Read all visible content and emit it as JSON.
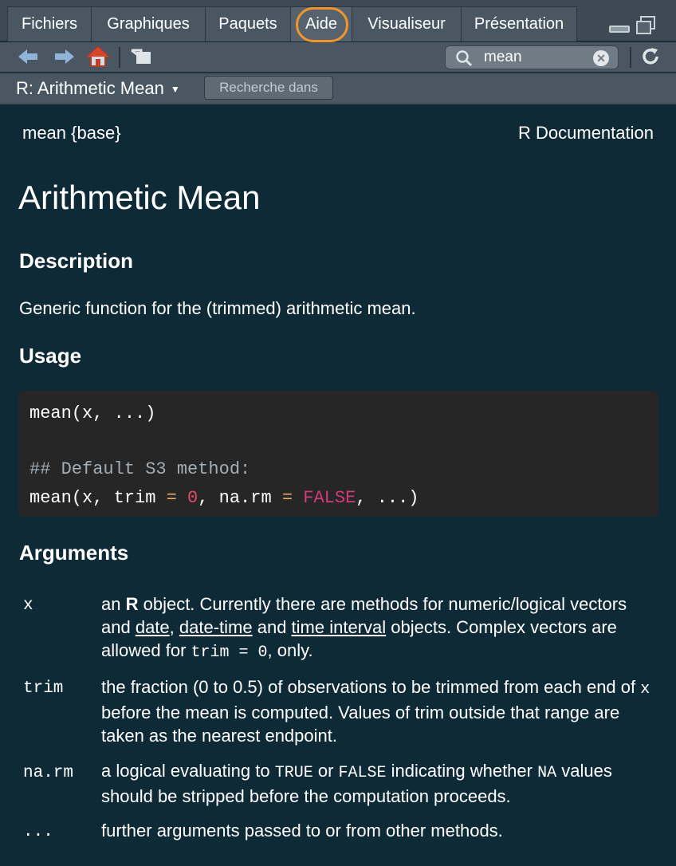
{
  "tabs": [
    {
      "label": "Fichiers"
    },
    {
      "label": "Graphiques"
    },
    {
      "label": "Paquets"
    },
    {
      "label": "Aide"
    },
    {
      "label": "Visualiseur"
    },
    {
      "label": "Présentation"
    }
  ],
  "active_tab": "Aide",
  "toolbar": {
    "icons": [
      "arrow-left-icon",
      "arrow-right-icon",
      "home-icon",
      "pop-out-icon",
      "refresh-icon"
    ],
    "search_value": "mean",
    "accent": "#f3952a"
  },
  "subbar": {
    "topic": "R: Arithmetic Mean",
    "search_in": "Recherche dans"
  },
  "doc": {
    "header_left": "mean {base}",
    "header_right": "R Documentation",
    "title": "Arithmetic Mean",
    "description_heading": "Description",
    "description": "Generic function for the (trimmed) arithmetic mean.",
    "usage_heading": "Usage",
    "usage": {
      "line1": "mean(x, ...)",
      "comment": "## Default S3 method:",
      "line3_a": "mean(x, trim ",
      "eq1": "=",
      "zero": " 0",
      "line3_b": ", na.rm ",
      "eq2": "=",
      "false_kw": " FALSE",
      "line3_c": ", ...)"
    },
    "arguments_heading": "Arguments",
    "args": {
      "x": {
        "name": "x",
        "t1": "an ",
        "bold_r": "R",
        "t2": " object. Currently there are methods for numeric/logical vectors and ",
        "link1": "date",
        "t3": ", ",
        "link2": "date-time",
        "t4": " and ",
        "link3": "time interval",
        "t5": " objects. Complex vectors are allowed for ",
        "code": "trim = 0",
        "t6": ", only."
      },
      "trim": {
        "name": "trim",
        "t1": "the fraction (0 to 0.5) of observations to be trimmed from each end of ",
        "code": "x",
        "t2": " before the mean is computed. Values of trim outside that range are taken as the nearest endpoint."
      },
      "narm": {
        "name": "na.rm",
        "t1": "a logical evaluating to ",
        "code1": "TRUE",
        "t2": " or ",
        "code2": "FALSE",
        "t3": " indicating whether ",
        "code3": "NA",
        "t4": " values should be stripped before the computation proceeds."
      },
      "dots": {
        "name": "...",
        "desc": "further arguments passed to or from other methods."
      }
    }
  }
}
